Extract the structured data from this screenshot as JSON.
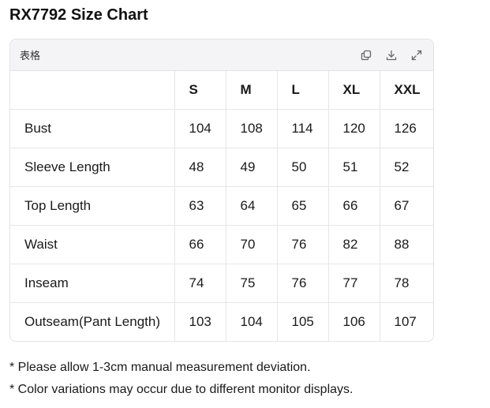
{
  "title": "RX7792 Size Chart",
  "card": {
    "label": "表格",
    "tools": [
      "copy-icon",
      "download-icon",
      "expand-icon"
    ]
  },
  "table": {
    "headers": [
      "",
      "S",
      "M",
      "L",
      "XL",
      "XXL"
    ],
    "rows": [
      [
        "Bust",
        "104",
        "108",
        "114",
        "120",
        "126"
      ],
      [
        "Sleeve Length",
        "48",
        "49",
        "50",
        "51",
        "52"
      ],
      [
        "Top Length",
        "63",
        "64",
        "65",
        "66",
        "67"
      ],
      [
        "Waist",
        "66",
        "70",
        "76",
        "82",
        "88"
      ],
      [
        "Inseam",
        "74",
        "75",
        "76",
        "77",
        "78"
      ],
      [
        "Outseam(Pant Length)",
        "103",
        "104",
        "105",
        "106",
        "107"
      ]
    ]
  },
  "notes": [
    "* Please allow 1-3cm manual measurement deviation.",
    "* Color variations may occur due to different monitor displays."
  ]
}
